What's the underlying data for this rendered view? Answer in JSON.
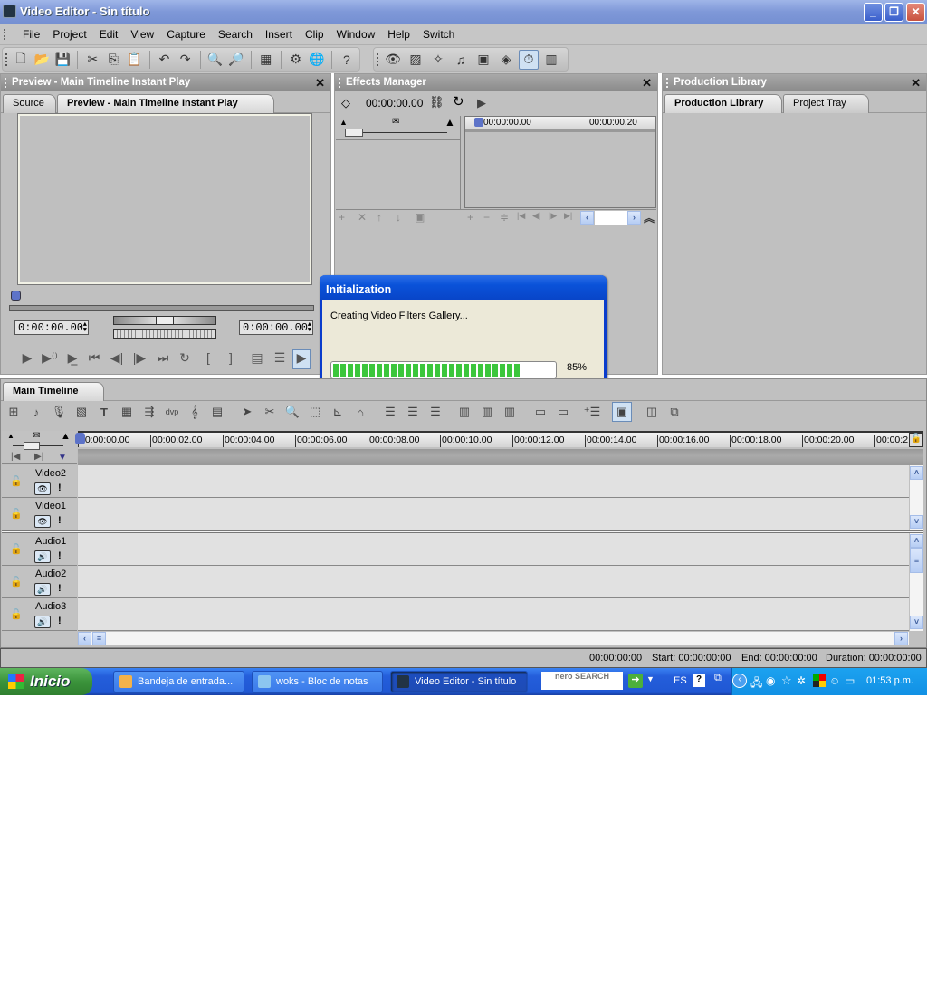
{
  "window": {
    "title": "Video Editor - Sin título"
  },
  "menu": [
    "File",
    "Project",
    "Edit",
    "View",
    "Capture",
    "Search",
    "Insert",
    "Clip",
    "Window",
    "Help",
    "Switch"
  ],
  "toolbar": {
    "main": [
      "new-file",
      "open-file",
      "save",
      "cut",
      "copy",
      "paste",
      "undo",
      "redo",
      "zoom-in",
      "zoom-out",
      "render",
      "settings",
      "web",
      "help"
    ],
    "views": [
      "preview-view",
      "effects-view",
      "magic-view",
      "audio-view",
      "library-view",
      "keyframe-view",
      "timecode-view",
      "split-view"
    ]
  },
  "preview_panel": {
    "title": "Preview - Main Timeline Instant Play",
    "tabs": [
      "Source",
      "Preview - Main Timeline Instant Play"
    ],
    "time_in": "0:00:00.00",
    "time_out": "0:00:00.00"
  },
  "effects_panel": {
    "title": "Effects Manager",
    "timecode": "00:00:00.00",
    "ruler": [
      "00:00:00.00",
      "00:00:00.20"
    ]
  },
  "library_panel": {
    "title": "Production Library",
    "tabs": [
      "Production Library",
      "Project Tray"
    ]
  },
  "dialog": {
    "title": "Initialization",
    "message": "Creating Video Filters Gallery...",
    "progress_percent": 85,
    "progress_label": "85%"
  },
  "timeline": {
    "tab": "Main Timeline",
    "ruler": [
      "00:00:00.00",
      "00:00:02.00",
      "00:00:04.00",
      "00:00:06.00",
      "00:00:08.00",
      "00:00:10.00",
      "00:00:12.00",
      "00:00:14.00",
      "00:00:16.00",
      "00:00:18.00",
      "00:00:20.00",
      "00:00:2"
    ],
    "tracks": [
      {
        "name": "Video2",
        "type": "video"
      },
      {
        "name": "Video1",
        "type": "video"
      },
      {
        "name": "Audio1",
        "type": "audio"
      },
      {
        "name": "Audio2",
        "type": "audio"
      },
      {
        "name": "Audio3",
        "type": "audio"
      }
    ]
  },
  "status": {
    "position": "00:00:00:00",
    "start": "Start: 00:00:00:00",
    "end": "End: 00:00:00:00",
    "duration": "Duration: 00:00:00:00"
  },
  "taskbar": {
    "start": "Inicio",
    "tasks": [
      "Bandeja de entrada...",
      "woks - Bloc de notas",
      "Video Editor - Sin título"
    ],
    "search_brand": "nero SEARCH",
    "lang": "ES",
    "clock": "01:53 p.m."
  }
}
